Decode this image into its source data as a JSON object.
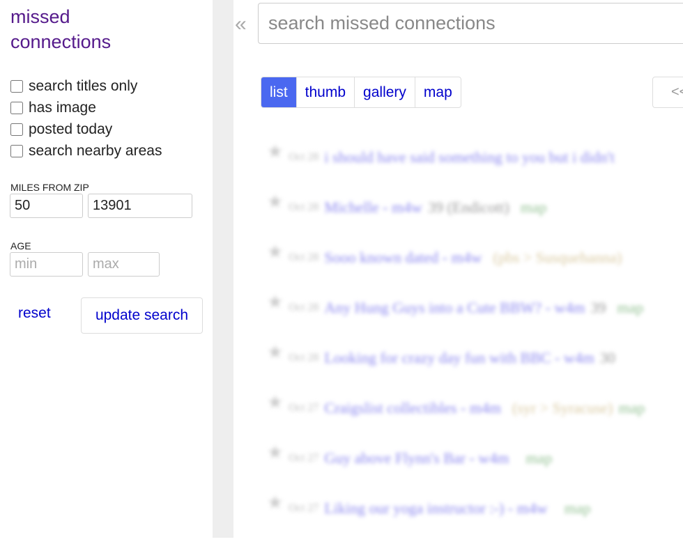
{
  "sidebar": {
    "title": "missed connections",
    "filters": [
      {
        "label": "search titles only",
        "checked": false
      },
      {
        "label": "has image",
        "checked": false
      },
      {
        "label": "posted today",
        "checked": false
      },
      {
        "label": "search nearby areas",
        "checked": false
      }
    ],
    "miles_label": "MILES FROM ZIP",
    "miles": "50",
    "zip": "13901",
    "age_label": "AGE",
    "age_min_placeholder": "min",
    "age_max_placeholder": "max",
    "reset": "reset",
    "update": "update search"
  },
  "collapse_icon": "«",
  "search": {
    "placeholder": "search missed connections",
    "value": ""
  },
  "views": [
    "list",
    "thumb",
    "gallery",
    "map"
  ],
  "pager": {
    "prev": "<<"
  },
  "results": [
    {
      "date": "Oct 28",
      "title": "i should have said something to you but i didn't",
      "meta": "",
      "hood": "",
      "map": ""
    },
    {
      "date": "Oct 28",
      "title": "Michelle - m4w",
      "meta": "39 (Endicott)",
      "hood": "",
      "map": "map"
    },
    {
      "date": "Oct 28",
      "title": "Sooo known dated - m4w",
      "meta": "",
      "hood": "(pbs > Susquehanna)",
      "map": ""
    },
    {
      "date": "Oct 28",
      "title": "Any Hung Guys into a Cute BBW? - w4m",
      "meta": "39",
      "hood": "",
      "map": "map"
    },
    {
      "date": "Oct 28",
      "title": "Looking for crazy day fun with BBC - w4m",
      "meta": "30",
      "hood": "",
      "map": ""
    },
    {
      "date": "Oct 27",
      "title": "Craigslist collectibles - m4m",
      "meta": "",
      "hood": "(syr > Syracuse)",
      "map": "map"
    },
    {
      "date": "Oct 27",
      "title": "Guy above Flynn's Bar - w4m",
      "meta": "",
      "hood": "",
      "map": "map"
    },
    {
      "date": "Oct 27",
      "title": "Liking our yoga instructor :-) - m4w",
      "meta": "",
      "hood": "",
      "map": "map"
    }
  ]
}
